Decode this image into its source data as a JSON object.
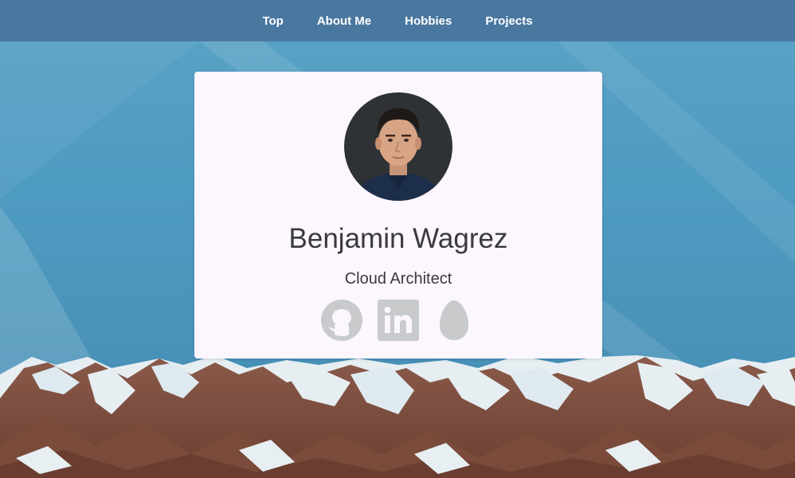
{
  "nav": {
    "items": [
      {
        "label": "Top"
      },
      {
        "label": "About Me"
      },
      {
        "label": "Hobbies"
      },
      {
        "label": "Projects"
      }
    ]
  },
  "profile": {
    "name": "Benjamin Wagrez",
    "title": "Cloud Architect",
    "avatar": "profile-photo"
  },
  "social": [
    {
      "icon": "github-icon"
    },
    {
      "icon": "linkedin-icon"
    },
    {
      "icon": "egg-icon"
    }
  ],
  "colors": {
    "navbar": "#4a77a0",
    "card": "#fcf6ff",
    "text": "#3a3a3a",
    "social_icon": "#c8cacc",
    "sky": "#4e9bc1"
  }
}
